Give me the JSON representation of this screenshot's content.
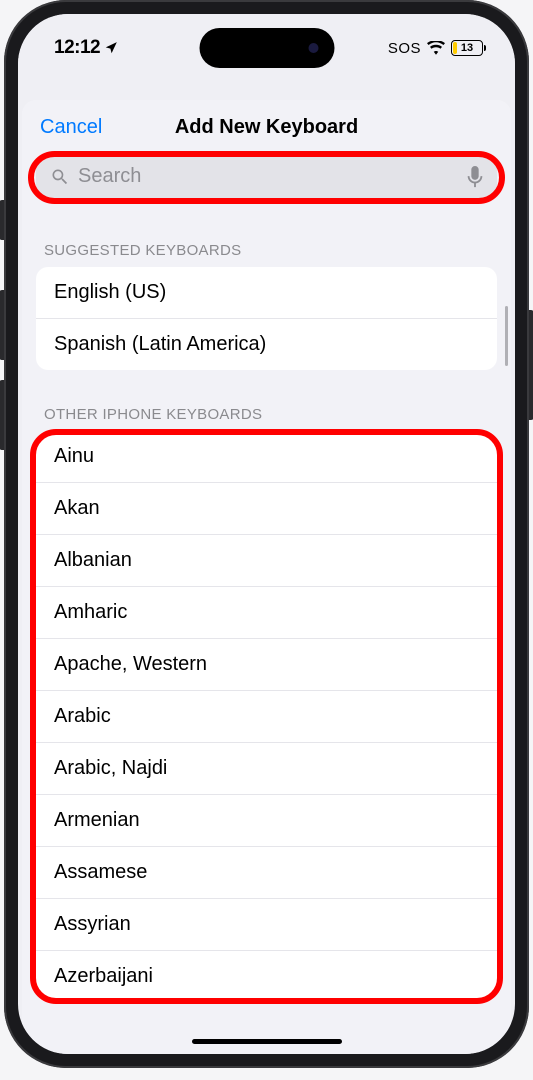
{
  "status": {
    "time": "12:12",
    "sos": "SOS",
    "battery_pct": "13",
    "battery_color": "#ffcc00"
  },
  "nav": {
    "cancel": "Cancel",
    "title": "Add New Keyboard"
  },
  "search": {
    "placeholder": "Search"
  },
  "sections": {
    "suggested_header": "SUGGESTED KEYBOARDS",
    "suggested_items": [
      "English (US)",
      "Spanish (Latin America)"
    ],
    "other_header": "OTHER IPHONE KEYBOARDS",
    "other_items": [
      "Ainu",
      "Akan",
      "Albanian",
      "Amharic",
      "Apache, Western",
      "Arabic",
      "Arabic, Najdi",
      "Armenian",
      "Assamese",
      "Assyrian",
      "Azerbaijani"
    ]
  }
}
